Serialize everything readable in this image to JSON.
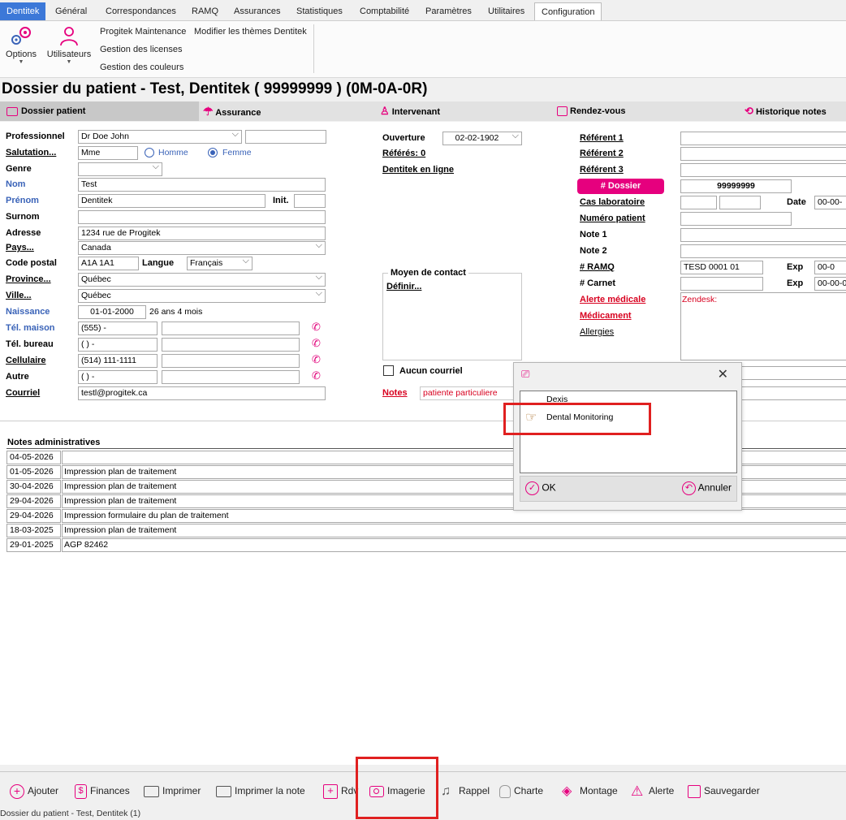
{
  "menu": {
    "tabs": [
      "Dentitek",
      "Général",
      "Correspondances",
      "RAMQ",
      "Assurances",
      "Statistiques",
      "Comptabilité",
      "Paramètres",
      "Utilitaires",
      "Configuration"
    ]
  },
  "ribbon": {
    "options_label": "Options",
    "users_label": "Utilisateurs",
    "links": [
      "Progitek Maintenance",
      "Modifier les thèmes Dentitek",
      "Gestion des licenses",
      "Gestion des couleurs"
    ]
  },
  "title": "Dossier du patient - Test, Dentitek ( 99999999 )  (0M-0A-0R)",
  "patient_tabs": [
    "Dossier patient",
    "Assurance",
    "Intervenant",
    "Rendez-vous",
    "Historique notes"
  ],
  "labels": {
    "professionnel": "Professionnel",
    "salutation": "Salutation...",
    "genre": "Genre",
    "nom": "Nom",
    "prenom": "Prénom",
    "init": "Init.",
    "surnom": "Surnom",
    "adresse": "Adresse",
    "pays": "Pays...",
    "code_postal": "Code postal",
    "langue": "Langue",
    "province": "Province...",
    "ville": "Ville...",
    "naissance": "Naissance",
    "tel_maison": "Tél. maison",
    "tel_bureau": "Tél. bureau",
    "cellulaire": "Cellulaire",
    "autre": "Autre",
    "courriel": "Courriel",
    "homme": "Homme",
    "femme": "Femme",
    "ouverture": "Ouverture",
    "referes": "Référés: 0",
    "dentitek_en_ligne": "Dentitek en ligne",
    "moyen_contact": "Moyen de contact",
    "definir": "Définir...",
    "aucun_courriel": "Aucun courriel",
    "notes": "Notes",
    "referent1": "Référent 1",
    "referent2": "Référent 2",
    "referent3": "Référent 3",
    "dossier": "# Dossier",
    "cas_laboratoire": "Cas laboratoire",
    "date": "Date",
    "numero_patient": "Numéro patient",
    "note1": "Note 1",
    "note2": "Note 2",
    "ramq": "# RAMQ",
    "exp": "Exp",
    "carnet": "# Carnet",
    "alerte_medicale": "Alerte médicale",
    "medicament": "Médicament",
    "allergies": "Allergies",
    "zendesk": "Zendesk:"
  },
  "values": {
    "professionnel": "Dr Doe John",
    "salutation": "Mme",
    "nom": "Test",
    "prenom": "Dentitek",
    "adresse": "1234 rue de Progitek",
    "pays": "Canada",
    "code_postal": "A1A 1A1",
    "langue": "Français",
    "province": "Québec",
    "ville": "Québec",
    "naissance": "01-01-2000",
    "age": "26 ans 4 mois",
    "tel_maison": "(555)    -",
    "tel_bureau": "(   )    -",
    "cellulaire": "(514) 111-1111",
    "autre": "(   )    -",
    "courriel": "testl@progitek.ca",
    "ouverture": "02-02-1902",
    "notes": "patiente particuliere",
    "dossier": "99999999",
    "date": "00-00-",
    "ramq": "TESD 0001 01",
    "ramq_exp": "00-0",
    "carnet_exp": "00-00-0"
  },
  "notes_admin": {
    "header": "Notes administratives",
    "rows": [
      {
        "date": "04-05-2026",
        "text": ""
      },
      {
        "date": "01-05-2026",
        "text": "Impression plan de traitement"
      },
      {
        "date": "30-04-2026",
        "text": "Impression plan de traitement"
      },
      {
        "date": "29-04-2026",
        "text": "Impression plan de traitement"
      },
      {
        "date": "29-04-2026",
        "text": "Impression formulaire du plan de traitement"
      },
      {
        "date": "18-03-2025",
        "text": "Impression plan de traitement"
      },
      {
        "date": "29-01-2025",
        "text": "AGP  82462"
      }
    ]
  },
  "dialog": {
    "items": [
      "Dexis",
      "Dental Monitoring"
    ],
    "ok": "OK",
    "cancel": "Annuler"
  },
  "toolbar": [
    "Ajouter",
    "Finances",
    "Imprimer",
    "Imprimer la note",
    "Rdv",
    "Imagerie",
    "Rappel",
    "Charte",
    "Montage",
    "Alerte",
    "Sauvegarder"
  ],
  "status": "Dossier du patient - Test, Dentitek (1)",
  "colors": {
    "accent": "#e6007e",
    "brand": "#3c78d8",
    "highlight": "#e02020"
  }
}
